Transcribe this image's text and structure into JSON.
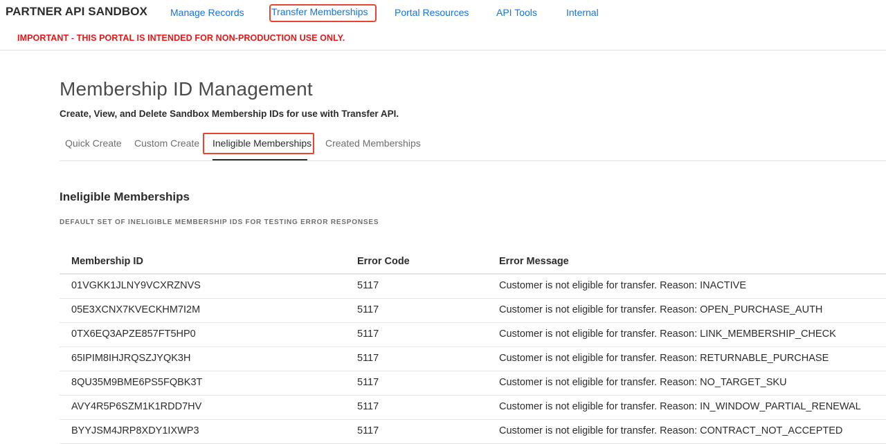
{
  "header": {
    "brand": "PARTNER API SANDBOX",
    "nav": [
      {
        "label": "Manage Records",
        "name": "nav-manage-records"
      },
      {
        "label": "Transfer Memberships",
        "name": "nav-transfer-memberships"
      },
      {
        "label": "Portal Resources",
        "name": "nav-portal-resources"
      },
      {
        "label": "API Tools",
        "name": "nav-api-tools"
      },
      {
        "label": "Internal",
        "name": "nav-internal"
      }
    ],
    "warning": "IMPORTANT - THIS PORTAL IS INTENDED FOR NON-PRODUCTION USE ONLY."
  },
  "page": {
    "title": "Membership ID Management",
    "subtitle": "Create, View, and Delete Sandbox Membership IDs for use with Transfer API."
  },
  "tabs": [
    {
      "label": "Quick Create"
    },
    {
      "label": "Custom Create"
    },
    {
      "label": "Ineligible Memberships",
      "active": true
    },
    {
      "label": "Created Memberships"
    }
  ],
  "section": {
    "title": "Ineligible Memberships",
    "description": "DEFAULT SET OF INELIGIBLE MEMBERSHIP IDS FOR TESTING ERROR RESPONSES"
  },
  "table": {
    "columns": [
      "Membership ID",
      "Error Code",
      "Error Message"
    ],
    "rows": [
      [
        "01VGKK1JLNY9VCXRZNVS",
        "5117",
        "Customer is not eligible for transfer. Reason: INACTIVE"
      ],
      [
        "05E3XCNX7KVECKHM7I2M",
        "5117",
        "Customer is not eligible for transfer. Reason: OPEN_PURCHASE_AUTH"
      ],
      [
        "0TX6EQ3APZE857FT5HP0",
        "5117",
        "Customer is not eligible for transfer. Reason: LINK_MEMBERSHIP_CHECK"
      ],
      [
        "65IPIM8IHJRQSZJYQK3H",
        "5117",
        "Customer is not eligible for transfer. Reason: RETURNABLE_PURCHASE"
      ],
      [
        "8QU35M9BME6PS5FQBK3T",
        "5117",
        "Customer is not eligible for transfer. Reason: NO_TARGET_SKU"
      ],
      [
        "AVY4R5P6SZM1K1RDD7HV",
        "5117",
        "Customer is not eligible for transfer. Reason: IN_WINDOW_PARTIAL_RENEWAL"
      ],
      [
        "BYYJSM4JRP8XDY1IXWP3",
        "5117",
        "Customer is not eligible for transfer. Reason: CONTRACT_NOT_ACCEPTED"
      ]
    ]
  },
  "colors": {
    "link": "#1473e6",
    "warning": "#e51717",
    "highlight": "#e8442f"
  }
}
